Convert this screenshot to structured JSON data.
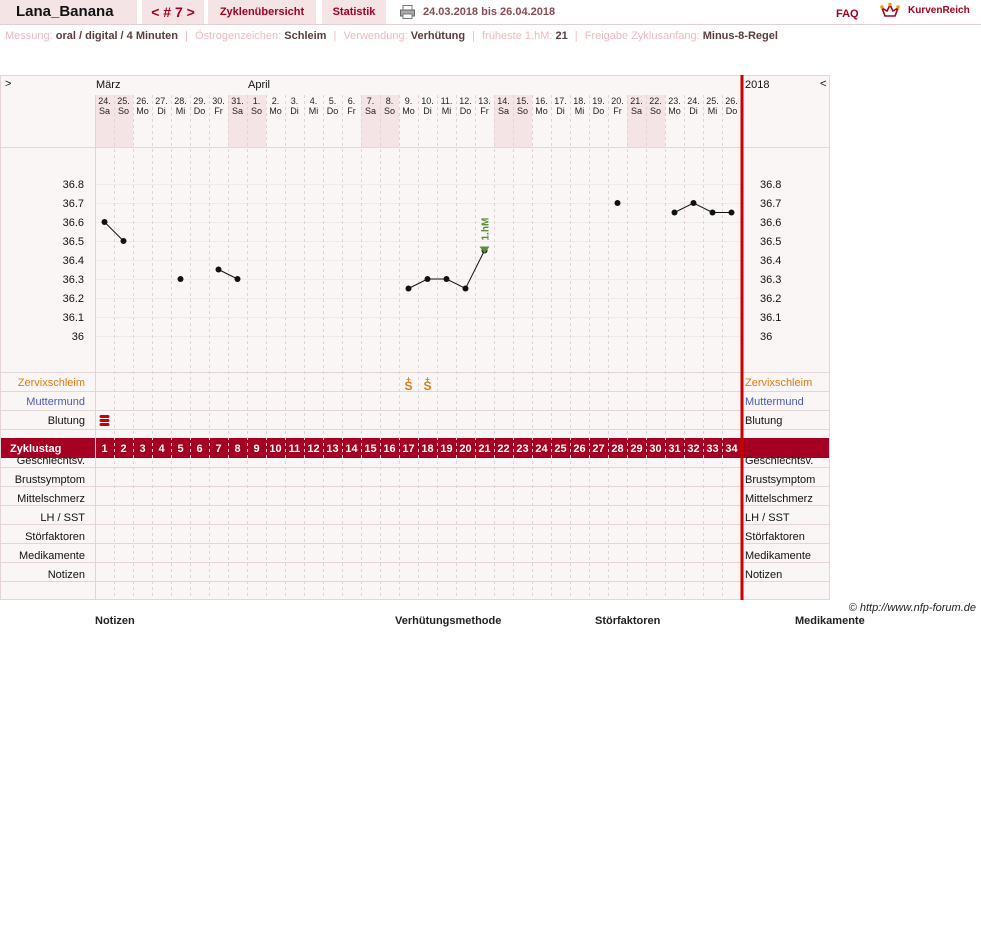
{
  "header": {
    "username": "Lana_Banana",
    "cycle_nav": "< # 7 >",
    "tab_overview": "Zyklenübersicht",
    "tab_statistics": "Statistik",
    "date_range": "24.03.2018 bis 26.04.2018",
    "faq": "FAQ",
    "logo_text": "KurvenReich",
    "print_icon": "printer-icon",
    "logo_icon": "crown-icon"
  },
  "info": {
    "measure_label": "Messung:",
    "measure_value": "oral / digital / 4 Minuten",
    "estrogen_label": "Östrogenzeichen:",
    "estrogen_value": "Schleim",
    "usage_label": "Verwendung:",
    "usage_value": "Verhütung",
    "earliest_label": "früheste 1.hM:",
    "earliest_value": "21",
    "release_label": "Freigabe Zyklusanfang:",
    "release_value": "Minus-8-Regel"
  },
  "colors": {
    "brand": "#a50021",
    "header_bg": "#f5e4e6",
    "weekend": "#f5e4e6",
    "mucus": "#e07a10",
    "cervix": "#4a5ab8",
    "hm_marker": "#5b8c3a"
  },
  "chart_data": {
    "type": "line",
    "nav_left": ">",
    "nav_right": "<",
    "year": "2018",
    "month_labels": [
      {
        "day_index": 0,
        "label": "März"
      },
      {
        "day_index": 8,
        "label": "April"
      }
    ],
    "dates": [
      "24.",
      "25.",
      "26.",
      "27.",
      "28.",
      "29.",
      "30.",
      "31.",
      "1.",
      "2.",
      "3.",
      "4.",
      "5.",
      "6.",
      "7.",
      "8.",
      "9.",
      "10.",
      "11.",
      "12.",
      "13.",
      "14.",
      "15.",
      "16.",
      "17.",
      "18.",
      "19.",
      "20.",
      "21.",
      "22.",
      "23.",
      "24.",
      "25.",
      "26."
    ],
    "weekdays": [
      "Sa",
      "So",
      "Mo",
      "Di",
      "Mi",
      "Do",
      "Fr",
      "Sa",
      "So",
      "Mo",
      "Di",
      "Mi",
      "Do",
      "Fr",
      "Sa",
      "So",
      "Mo",
      "Di",
      "Mi",
      "Do",
      "Fr",
      "Sa",
      "So",
      "Mo",
      "Di",
      "Mi",
      "Do",
      "Fr",
      "Sa",
      "So",
      "Mo",
      "Di",
      "Mi",
      "Do"
    ],
    "highlight_days": [
      1,
      2,
      8,
      9,
      15,
      16,
      22,
      23,
      29,
      30
    ],
    "cycle_day_label": "Zyklustag",
    "cycle_days": [
      1,
      2,
      3,
      4,
      5,
      6,
      7,
      8,
      9,
      10,
      11,
      12,
      13,
      14,
      15,
      16,
      17,
      18,
      19,
      20,
      21,
      22,
      23,
      24,
      25,
      26,
      27,
      28,
      29,
      30,
      31,
      32,
      33,
      34
    ],
    "y_ticks": [
      "36.8",
      "36.7",
      "36.6",
      "36.5",
      "36.4",
      "36.3",
      "36.2",
      "36.1",
      "36"
    ],
    "ylim": [
      35.9,
      36.9
    ],
    "temperatures": [
      36.6,
      36.5,
      null,
      null,
      36.3,
      null,
      36.35,
      36.3,
      null,
      null,
      null,
      null,
      null,
      null,
      null,
      null,
      36.25,
      36.3,
      36.3,
      36.25,
      36.45,
      null,
      null,
      null,
      null,
      null,
      null,
      36.7,
      null,
      null,
      36.65,
      36.7,
      36.65,
      36.65
    ],
    "line_segments": [
      [
        1,
        2
      ],
      [
        7,
        8
      ],
      [
        17,
        21
      ],
      [
        31,
        34
      ]
    ],
    "hm_day": 21,
    "hm_label": "1.hM",
    "mucus_days": [
      17,
      18
    ],
    "mucus_symbol": "S+",
    "bleeding_days": [
      1
    ],
    "rows_top": {
      "mucus": "Zervixschleim",
      "cervix": "Muttermund",
      "bleeding": "Blutung"
    },
    "rows_bottom": [
      "Geschlechtsv.",
      "Brustsymptom",
      "Mittelschmerz",
      "LH / SST",
      "Störfaktoren",
      "Medikamente",
      "Notizen"
    ]
  },
  "footer": {
    "copyright": "© http://www.nfp-forum.de",
    "notes": "Notizen",
    "method": "Verhütungsmethode",
    "disturbances": "Störfaktoren",
    "medications": "Medikamente"
  }
}
